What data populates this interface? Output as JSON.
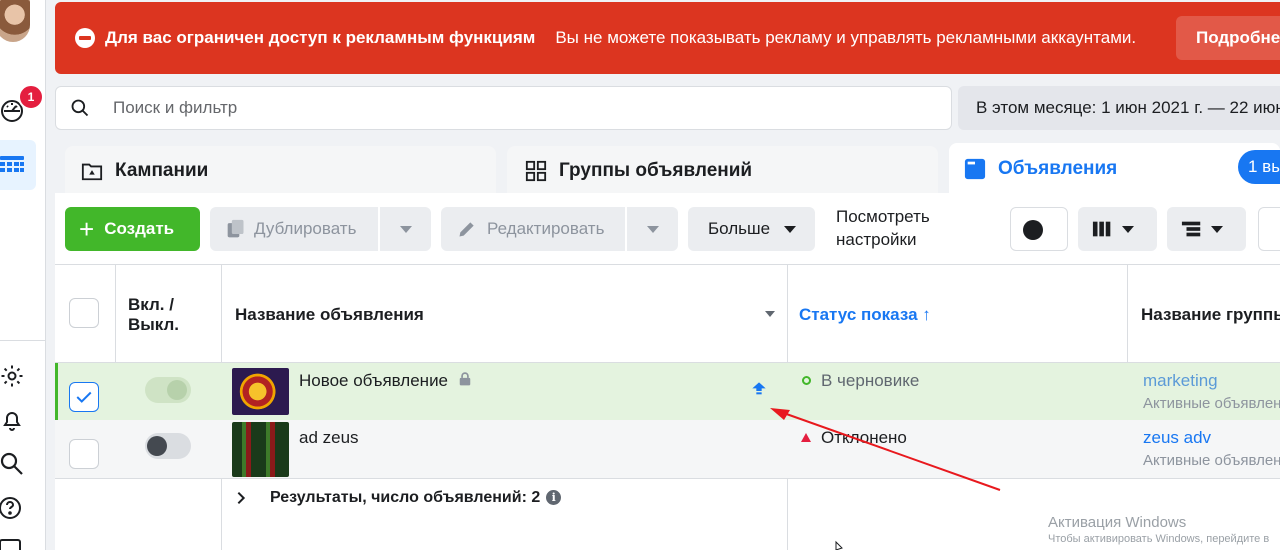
{
  "sidebar": {
    "notification_count": "1",
    "icons": [
      "avatar",
      "dashboard-icon",
      "grid-icon",
      "gear-icon",
      "bell-icon",
      "search-icon",
      "help-icon",
      "report-icon"
    ]
  },
  "banner": {
    "title": "Для вас ограничен доступ к рекламным функциям",
    "message": "Вы не можете показывать рекламу и управлять рекламными аккаунтами.",
    "button": "Подробнее",
    "color": "#dc3520"
  },
  "search": {
    "placeholder": "Поиск и фильтр"
  },
  "date_range": {
    "label": "В этом месяце: 1 июн 2021 г. — 22 июн"
  },
  "tabs": [
    {
      "label": "Кампании"
    },
    {
      "label": "Группы объявлений"
    },
    {
      "label": "Объявления",
      "active": true,
      "pill": "1 вы"
    }
  ],
  "toolbar": {
    "create": "Создать",
    "duplicate": "Дублировать",
    "edit": "Редактировать",
    "more": "Больше",
    "view_settings": "Посмотреть настройки"
  },
  "table": {
    "headers": {
      "toggle": "Вкл. / Выкл.",
      "name": "Название объявления",
      "status": "Статус показа",
      "group": "Название группы"
    },
    "rows": [
      {
        "name": "Новое объявление",
        "status": "В черновике",
        "group": "marketing",
        "group_sub": "Активные объявлен",
        "selected": true,
        "toggle_on": false
      },
      {
        "name": "ad zeus",
        "status": "Отклонено",
        "group": "zeus adv",
        "group_sub": "Активные объявлен",
        "selected": false,
        "toggle_on": false
      }
    ],
    "results": "Результаты, число объявлений: 2"
  },
  "watermark": {
    "title": "Активация Windows",
    "subtitle": "Чтобы активировать Windows, перейдите в"
  },
  "colors": {
    "accent": "#1877f2",
    "create": "#42b72a",
    "selected_row": "#e4f3df",
    "annotation_arrow": "#e8191e"
  }
}
